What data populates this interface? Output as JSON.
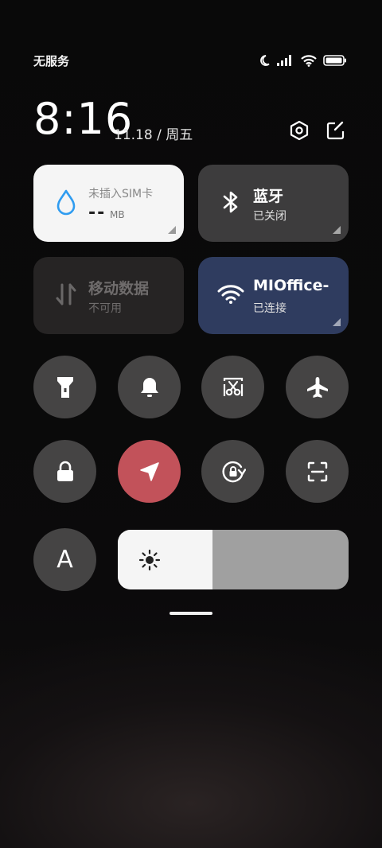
{
  "status_bar": {
    "carrier": "无服务",
    "icons": [
      "moon-icon",
      "signal-icon",
      "wifi-icon",
      "battery-icon"
    ],
    "battery_level": 1.0
  },
  "header": {
    "time": "8:16",
    "date": "11.18 / 周五",
    "buttons": [
      "settings-icon",
      "edit-icon"
    ]
  },
  "tiles": {
    "data_usage": {
      "title": "未插入SIM卡",
      "value": "--",
      "unit": "MB",
      "icon": "water-drop-icon",
      "accent": "#2f9cf0"
    },
    "bluetooth": {
      "title": "蓝牙",
      "status": "已关闭",
      "icon": "bluetooth-icon"
    },
    "mobile_data": {
      "title": "移动数据",
      "status": "不可用",
      "icon": "mobile-data-icon"
    },
    "wifi": {
      "title": "MIOffice-",
      "status": "已连接",
      "icon": "wifi-icon",
      "color": "#2f3c5f"
    }
  },
  "toggles": [
    {
      "name": "flashlight",
      "icon": "flashlight-icon",
      "active": false
    },
    {
      "name": "ringer",
      "icon": "bell-icon",
      "active": false
    },
    {
      "name": "screenshot",
      "icon": "scissors-icon",
      "active": false
    },
    {
      "name": "airplane-mode",
      "icon": "airplane-icon",
      "active": false
    },
    {
      "name": "lock-screen",
      "icon": "lock-icon",
      "active": false
    },
    {
      "name": "location",
      "icon": "location-arrow-icon",
      "active": true,
      "color": "#c2525a"
    },
    {
      "name": "rotation-lock",
      "icon": "rotation-lock-icon",
      "active": false
    },
    {
      "name": "scanner",
      "icon": "scan-icon",
      "active": false
    }
  ],
  "brightness": {
    "auto_label": "A",
    "level": 0.41,
    "icon": "sun-icon"
  }
}
